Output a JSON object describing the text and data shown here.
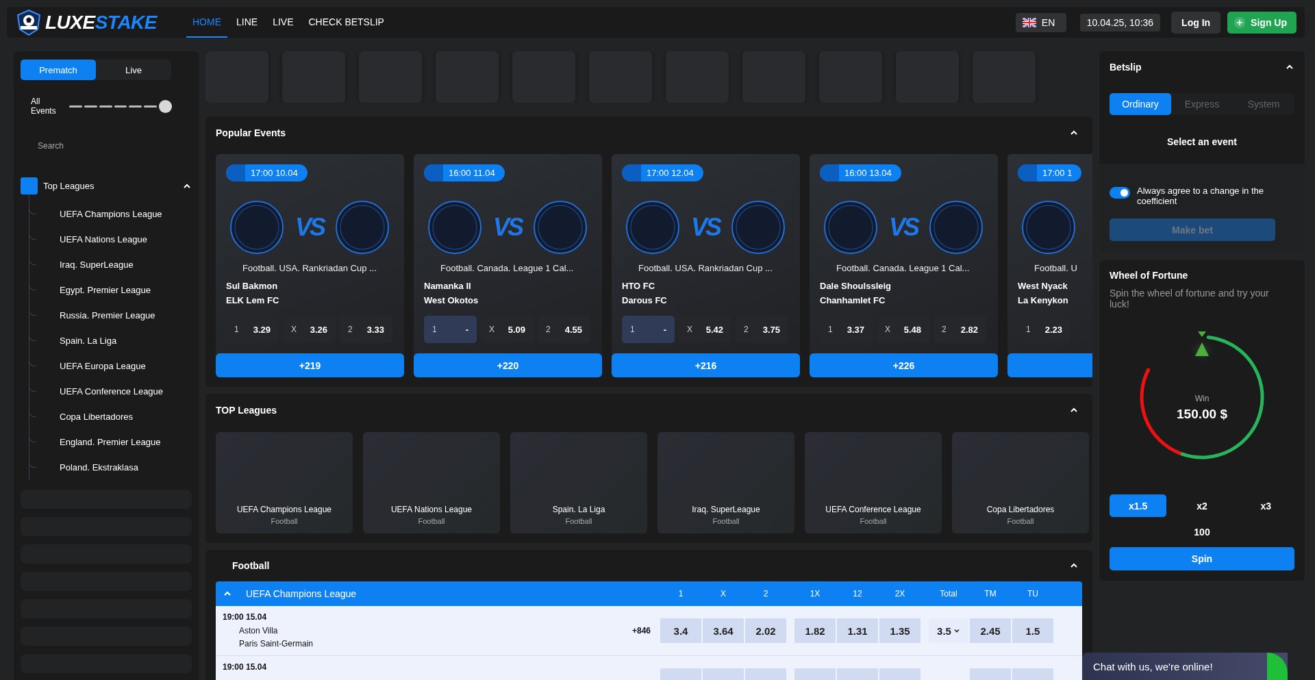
{
  "header": {
    "logo": {
      "first": "LUXE",
      "second": "STAKE"
    },
    "nav": [
      {
        "label": "HOME",
        "selected": true
      },
      {
        "label": "LINE",
        "selected": false
      },
      {
        "label": "LIVE",
        "selected": false
      },
      {
        "label": "CHECK BETSLIP",
        "selected": false
      }
    ],
    "language": "EN",
    "datetime": "10.04.25, 10:36",
    "login": "Log In",
    "signup": "Sign Up"
  },
  "sidebar": {
    "modes": [
      {
        "label": "Prematch",
        "selected": true
      },
      {
        "label": "Live",
        "selected": false
      }
    ],
    "filter": {
      "label": "All Events",
      "level": 1
    },
    "search": {
      "placeholder": "Search"
    },
    "tree": {
      "label": "Top Leagues",
      "expanded": true,
      "children": [
        {
          "label": "UEFA Champions League"
        },
        {
          "label": "UEFA Nations League"
        },
        {
          "label": "Iraq. SuperLeague"
        },
        {
          "label": "Egypt. Premier League"
        },
        {
          "label": "Russia. Premier League"
        },
        {
          "label": "Spain. La Liga"
        },
        {
          "label": "UEFA Europa League"
        },
        {
          "label": "UEFA Conference League"
        },
        {
          "label": "Copa Libertadores"
        },
        {
          "label": "England. Premier League"
        },
        {
          "label": "Poland. Ekstraklasa"
        }
      ]
    }
  },
  "popular_events": {
    "title": "Popular Events",
    "expanded": true,
    "cards": [
      {
        "time": "17:00 10.04",
        "vs": "VS",
        "league": "Football. USA. Rankriadan Cup ...",
        "teams": [
          "Sul Bakmon",
          "ELK Lem FC"
        ],
        "odds": [
          {
            "label": "1",
            "value": "3.29",
            "locked": false
          },
          {
            "label": "X",
            "value": "3.26",
            "locked": false
          },
          {
            "label": "2",
            "value": "3.33",
            "locked": false
          }
        ],
        "more": "+219"
      },
      {
        "time": "16:00 11.04",
        "vs": "VS",
        "league": "Football. Canada. League 1 Cal...",
        "teams": [
          "Namanka II",
          "West Okotos"
        ],
        "odds": [
          {
            "label": "1",
            "value": "-",
            "locked": true
          },
          {
            "label": "X",
            "value": "5.09",
            "locked": false
          },
          {
            "label": "2",
            "value": "4.55",
            "locked": false
          }
        ],
        "more": "+220"
      },
      {
        "time": "17:00 12.04",
        "vs": "VS",
        "league": "Football. USA. Rankriadan Cup ...",
        "teams": [
          "HTO FC",
          "Darous FC"
        ],
        "odds": [
          {
            "label": "1",
            "value": "-",
            "locked": true
          },
          {
            "label": "X",
            "value": "5.42",
            "locked": false
          },
          {
            "label": "2",
            "value": "3.75",
            "locked": false
          }
        ],
        "more": "+216"
      },
      {
        "time": "16:00 13.04",
        "vs": "VS",
        "league": "Football. Canada. League 1 Cal...",
        "teams": [
          "Dale Shoulssleig",
          "Chanhamlet FC"
        ],
        "odds": [
          {
            "label": "1",
            "value": "3.37",
            "locked": false
          },
          {
            "label": "X",
            "value": "5.48",
            "locked": false
          },
          {
            "label": "2",
            "value": "2.82",
            "locked": false
          }
        ],
        "more": "+226"
      },
      {
        "time": "17:00 1",
        "league": "Football. U",
        "teams": [
          "West Nyack",
          "La Kenykon"
        ],
        "odds": [
          {
            "label": "1",
            "value": "2.23",
            "locked": false
          }
        ]
      }
    ]
  },
  "top_leagues": {
    "title": "TOP Leagues",
    "expanded": true,
    "tiles": [
      {
        "title": "UEFA Champions League",
        "sport": "Football"
      },
      {
        "title": "UEFA Nations League",
        "sport": "Football"
      },
      {
        "title": "Spain. La Liga",
        "sport": "Football"
      },
      {
        "title": "Iraq. SuperLeague",
        "sport": "Football"
      },
      {
        "title": "UEFA Conference League",
        "sport": "Football"
      },
      {
        "title": "Copa Libertadores",
        "sport": "Football"
      }
    ]
  },
  "football": {
    "title": "Football",
    "expanded": true,
    "league": {
      "name": "UEFA Champions League",
      "expanded": true,
      "columns": [
        "1",
        "X",
        "2",
        "1X",
        "12",
        "2X",
        "Total",
        "TM",
        "TU"
      ],
      "rows": [
        {
          "time": "19:00 15.04",
          "teams": [
            "Aston Villa",
            "Paris Saint-Germain"
          ],
          "more": "+846",
          "odds": [
            "3.4",
            "3.64",
            "2.02",
            "1.82",
            "1.31",
            "1.35"
          ],
          "total": "3.5",
          "totals": [
            "2.45",
            "1.5"
          ]
        },
        {
          "time": "19:00 15.04"
        }
      ]
    }
  },
  "betslip": {
    "title": "Betslip",
    "expanded": true,
    "tabs": [
      {
        "label": "Ordinary",
        "selected": true
      },
      {
        "label": "Express",
        "selected": false
      },
      {
        "label": "System",
        "selected": false
      }
    ],
    "empty": "Select an event",
    "agree": {
      "label": "Always agree to a change in the coefficient",
      "on": true
    },
    "make_bet": {
      "label": "Make bet",
      "disabled": true
    }
  },
  "wheel": {
    "title": "Wheel of Fortune",
    "subtitle": "Spin the wheel of fortune and try your luck!",
    "win_label": "Win",
    "win_amount": "150.00 $",
    "multipliers": [
      {
        "label": "x1.5",
        "selected": true
      },
      {
        "label": "x2",
        "selected": false
      },
      {
        "label": "x3",
        "selected": false
      }
    ],
    "stake": "100",
    "spin": "Spin"
  },
  "chat": {
    "label": "Chat with us, we're online!"
  }
}
